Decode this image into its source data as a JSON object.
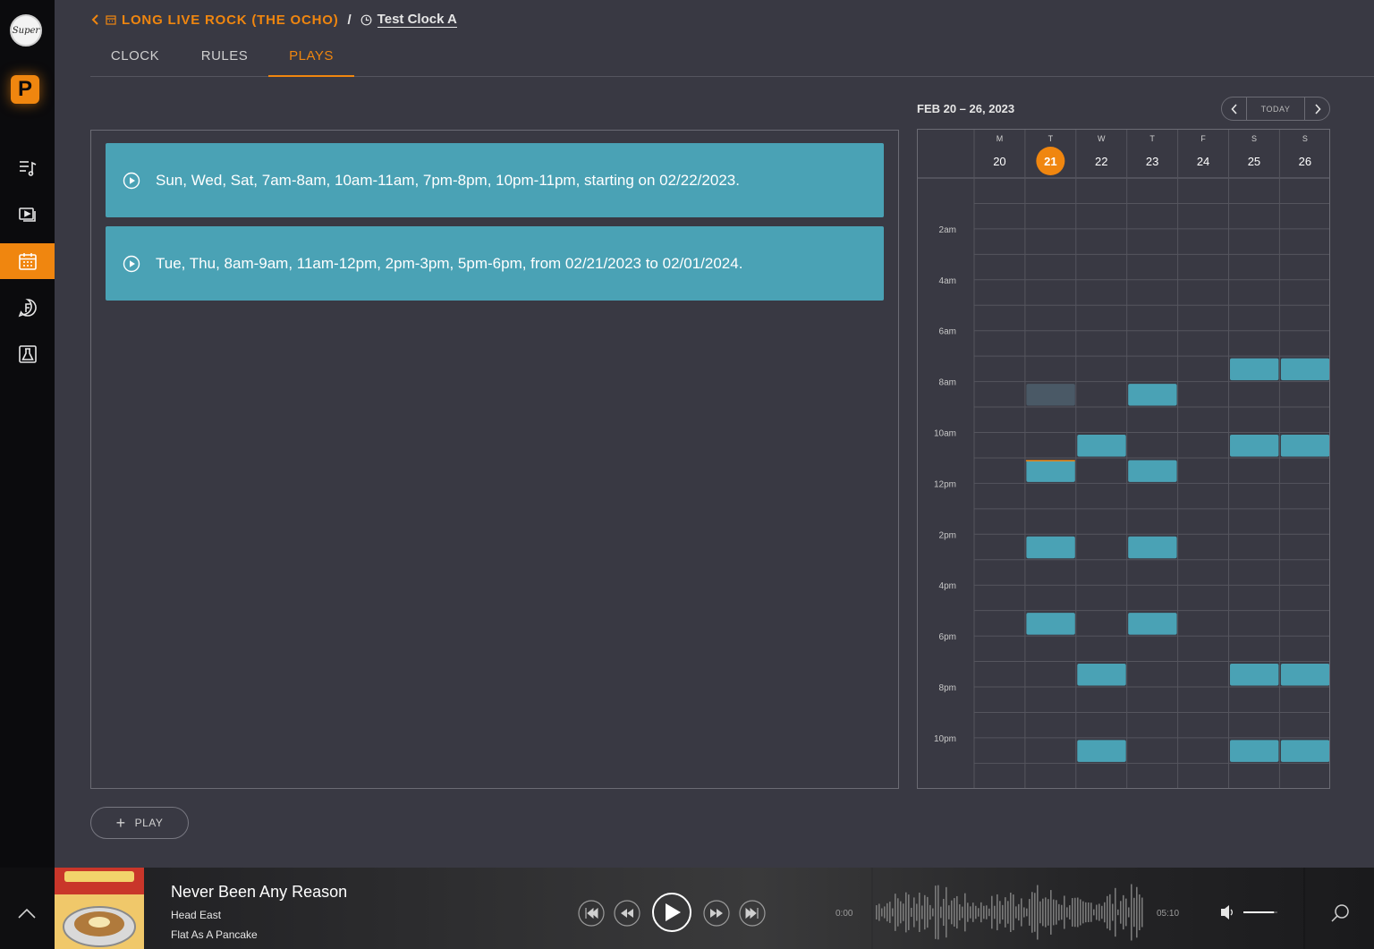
{
  "sidebar": {
    "logo_text": "Super",
    "badge_letter": "P",
    "items": [
      {
        "name": "playlist-icon",
        "active": false
      },
      {
        "name": "media-library-icon",
        "active": false
      },
      {
        "name": "calendar-icon",
        "active": true
      },
      {
        "name": "format-icon",
        "active": false
      },
      {
        "name": "lab-icon",
        "active": false
      }
    ]
  },
  "breadcrumb": {
    "parent": "LONG LIVE ROCK (THE OCHO)",
    "separator": "/",
    "current": "Test Clock A"
  },
  "tabs": [
    {
      "label": "CLOCK",
      "active": false
    },
    {
      "label": "RULES",
      "active": false
    },
    {
      "label": "PLAYS",
      "active": true
    }
  ],
  "rules": [
    {
      "text": "Sun, Wed, Sat, 7am-8am, 10am-11am, 7pm-8pm, 10pm-11pm, starting on 02/22/2023."
    },
    {
      "text": "Tue, Thu, 8am-9am, 11am-12pm, 2pm-3pm, 5pm-6pm, from 02/21/2023 to 02/01/2024."
    }
  ],
  "add_play_label": "PLAY",
  "calendar": {
    "title": "FEB 20 – 26, 2023",
    "today_label": "TODAY",
    "days": [
      {
        "letter": "M",
        "num": "20",
        "today": false
      },
      {
        "letter": "T",
        "num": "21",
        "today": true
      },
      {
        "letter": "W",
        "num": "22",
        "today": false
      },
      {
        "letter": "T",
        "num": "23",
        "today": false
      },
      {
        "letter": "F",
        "num": "24",
        "today": false
      },
      {
        "letter": "S",
        "num": "25",
        "today": false
      },
      {
        "letter": "S",
        "num": "26",
        "today": false
      }
    ],
    "hour_labels": [
      "2am",
      "4am",
      "6am",
      "8am",
      "10am",
      "12pm",
      "2pm",
      "4pm",
      "6pm",
      "8pm",
      "10pm"
    ],
    "hour_label_values": [
      2,
      4,
      6,
      8,
      10,
      12,
      14,
      16,
      18,
      20,
      22
    ],
    "events": [
      {
        "day": 5,
        "start": 7,
        "end": 8,
        "past": false
      },
      {
        "day": 6,
        "start": 7,
        "end": 8,
        "past": false
      },
      {
        "day": 1,
        "start": 8,
        "end": 9,
        "past": true
      },
      {
        "day": 3,
        "start": 8,
        "end": 9,
        "past": false
      },
      {
        "day": 2,
        "start": 10,
        "end": 11,
        "past": false
      },
      {
        "day": 5,
        "start": 10,
        "end": 11,
        "past": false
      },
      {
        "day": 6,
        "start": 10,
        "end": 11,
        "past": false
      },
      {
        "day": 1,
        "start": 11,
        "end": 12,
        "past": false
      },
      {
        "day": 3,
        "start": 11,
        "end": 12,
        "past": false
      },
      {
        "day": 1,
        "start": 14,
        "end": 15,
        "past": false
      },
      {
        "day": 3,
        "start": 14,
        "end": 15,
        "past": false
      },
      {
        "day": 1,
        "start": 17,
        "end": 18,
        "past": false
      },
      {
        "day": 3,
        "start": 17,
        "end": 18,
        "past": false
      },
      {
        "day": 2,
        "start": 19,
        "end": 20,
        "past": false
      },
      {
        "day": 5,
        "start": 19,
        "end": 20,
        "past": false
      },
      {
        "day": 6,
        "start": 19,
        "end": 20,
        "past": false
      },
      {
        "day": 2,
        "start": 22,
        "end": 23,
        "past": false
      },
      {
        "day": 5,
        "start": 22,
        "end": 23,
        "past": false
      },
      {
        "day": 6,
        "start": 22,
        "end": 23,
        "past": false
      }
    ],
    "now_day": 1,
    "now_hour": 11
  },
  "player": {
    "title": "Never Been Any Reason",
    "artist": "Head East",
    "album": "Flat As A Pancake",
    "elapsed": "0:00",
    "duration": "05:10",
    "volume_level": 0.9,
    "colors": {
      "accent": "#f0860f",
      "event": "#4aa2b5"
    }
  }
}
